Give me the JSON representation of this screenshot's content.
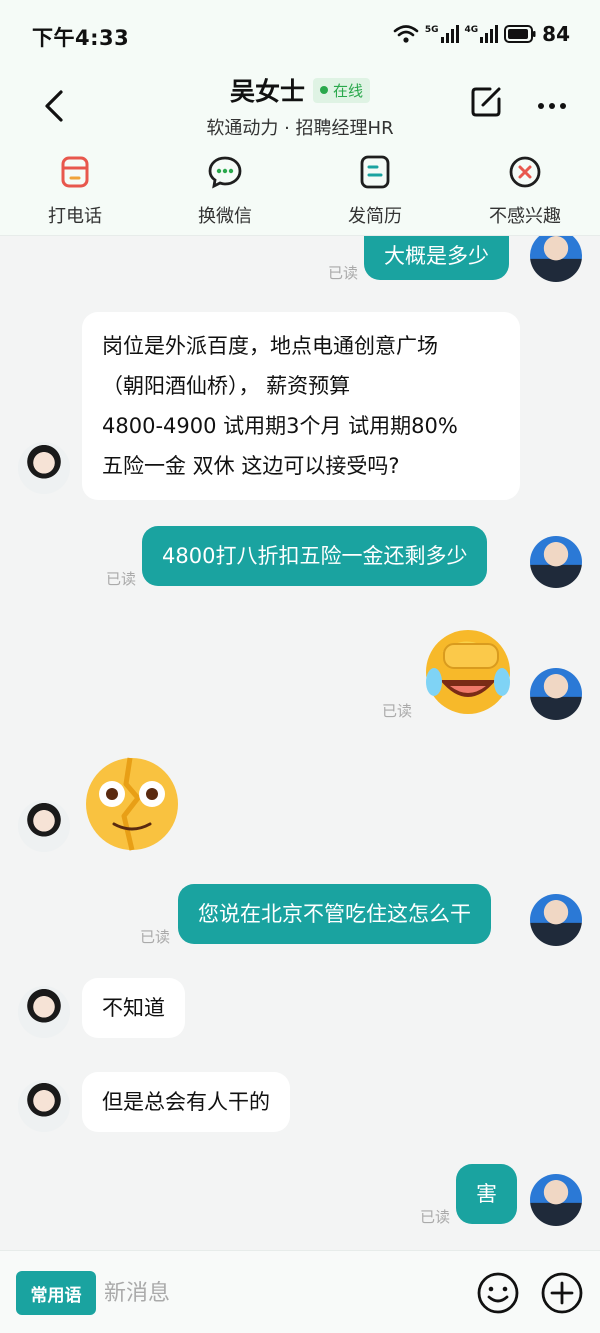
{
  "status_bar": {
    "time": "下午4:33",
    "battery": "84",
    "net1": "5G",
    "net2": "4G"
  },
  "header": {
    "contact_name": "吴女士",
    "online_label": "在线",
    "subtitle": "软通动力 · 招聘经理HR"
  },
  "actions": [
    {
      "label": "打电话",
      "icon": "phone-icon"
    },
    {
      "label": "换微信",
      "icon": "wechat-icon"
    },
    {
      "label": "发简历",
      "icon": "resume-icon"
    },
    {
      "label": "不感兴趣",
      "icon": "not-interested-icon"
    }
  ],
  "messages": [
    {
      "side": "out",
      "text": "大概是多少",
      "read": "已读"
    },
    {
      "side": "in",
      "lines": [
        "岗位是外派百度，地点电通创意广场",
        "（朝阳酒仙桥），  薪资预算",
        "4800-4900  试用期3个月 试用期80%",
        "五险一金 双休 这边可以接受吗?"
      ]
    },
    {
      "side": "out",
      "text": "4800打八折扣五险一金还剩多少",
      "read": "已读"
    },
    {
      "side": "out",
      "emoji": "laughing-crying-emoji",
      "read": "已读"
    },
    {
      "side": "in",
      "emoji": "broken-face-emoji"
    },
    {
      "side": "out",
      "text": "您说在北京不管吃住这怎么干",
      "read": "已读"
    },
    {
      "side": "in",
      "text": "不知道"
    },
    {
      "side": "in",
      "text": "但是总会有人干的"
    },
    {
      "side": "out",
      "text": "害",
      "read": "已读"
    }
  ],
  "input_bar": {
    "common_phrases_label": "常用语",
    "placeholder": "新消息"
  },
  "colors": {
    "accent": "#1aa3a0",
    "online": "#2aa84c",
    "header_bg": "#f5fbf7"
  }
}
